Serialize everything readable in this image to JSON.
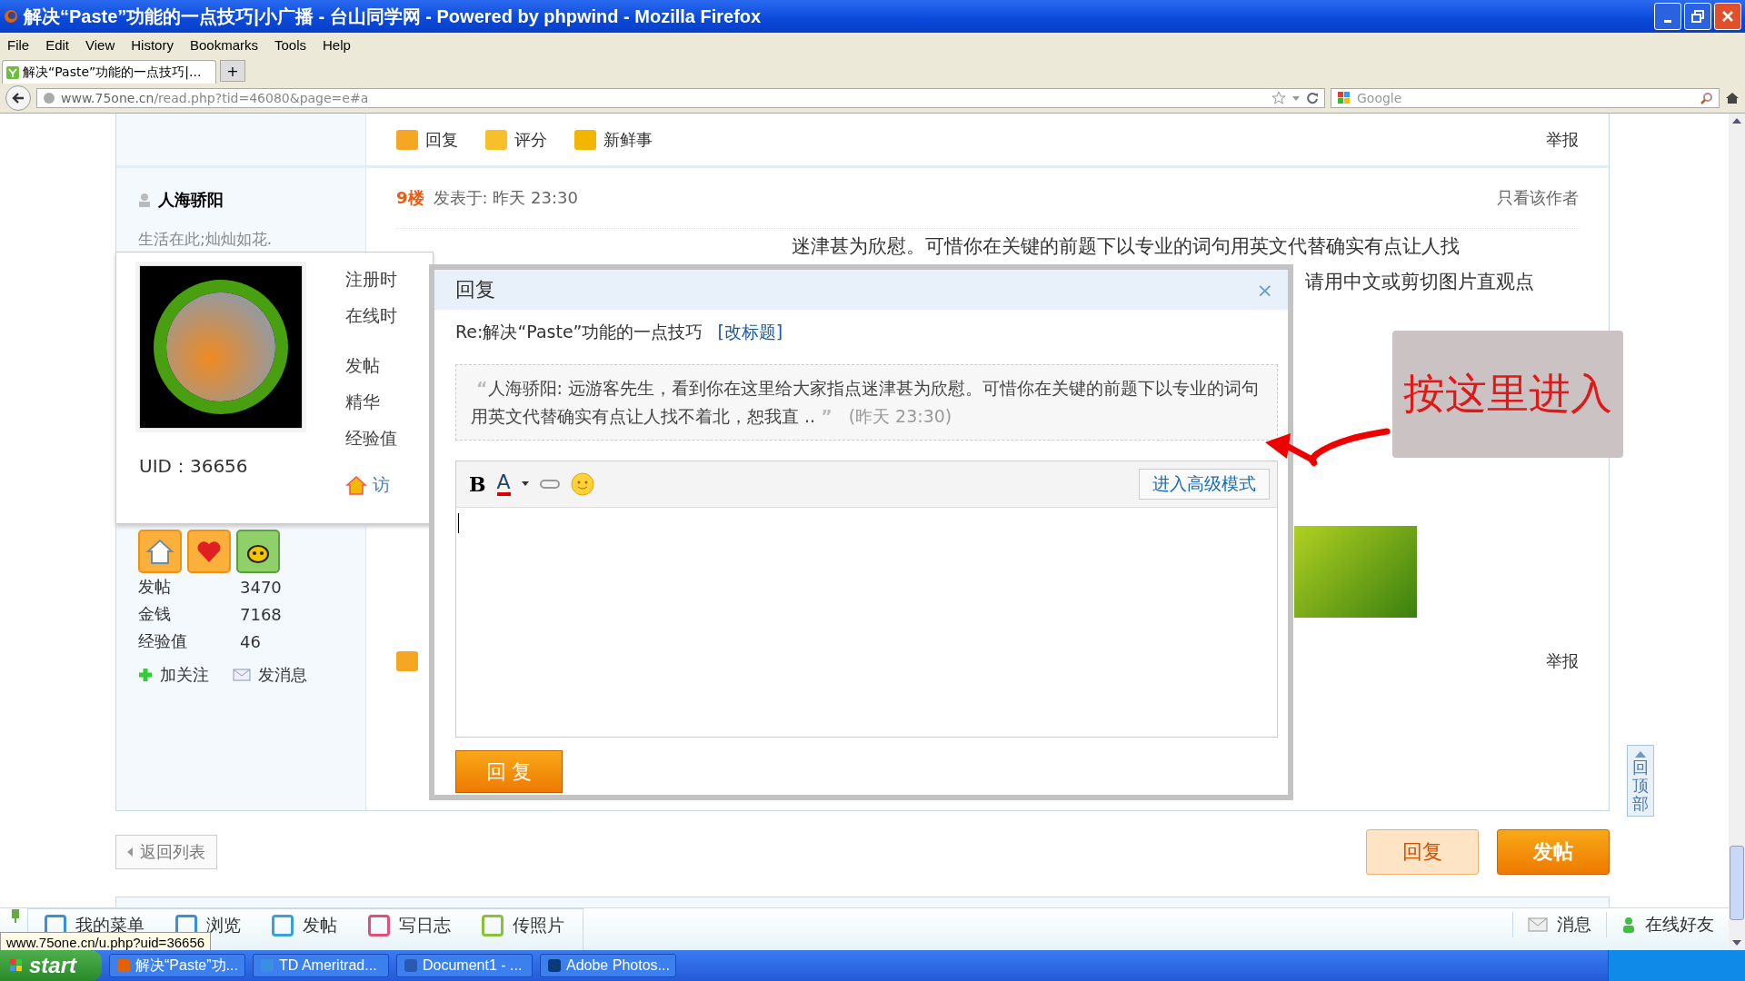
{
  "window": {
    "title": "解决“Paste”功能的一点技巧|小广播 - 台山同学网 - Powered by phpwind - Mozilla Firefox"
  },
  "menu": [
    "File",
    "Edit",
    "View",
    "History",
    "Bookmarks",
    "Tools",
    "Help"
  ],
  "tabs": [
    {
      "label": "解决“Paste”功能的一点技巧|...",
      "selected": true
    }
  ],
  "new_tab": "+",
  "address": {
    "domain": "www.75one.cn",
    "path": "/read.php?tid=46080&page=e#a"
  },
  "search": {
    "placeholder": "Google"
  },
  "prev_post_actions": {
    "items": [
      "回复",
      "评分",
      "新鲜事"
    ],
    "report": "举报"
  },
  "post": {
    "author": "人海骄阳",
    "signature": "生活在此;灿灿如花.",
    "floor": "9楼",
    "posted": "发表于: 昨天 23:30",
    "only_author": "只看该作者",
    "text_lines": [
      "迷津甚为欣慰。可惜你在关键的前题下以专业的词句用英文代替确实有点让人找",
      "请用中文或剪切图片直观点"
    ],
    "stats": [
      {
        "label": "发帖",
        "value": "3470"
      },
      {
        "label": "金钱",
        "value": "7168"
      },
      {
        "label": "经验值",
        "value": "46"
      }
    ],
    "follow": "加关注",
    "message": "发消息",
    "report": "举报"
  },
  "user_card": {
    "uid_label": "UID：",
    "uid": "36656",
    "fields": [
      "注册时",
      "在线时",
      "发帖",
      "精华",
      "经验值"
    ],
    "visit": "访"
  },
  "page_buttons": {
    "back": "返回列表",
    "reply": "回复",
    "new_post": "发帖"
  },
  "dialog": {
    "title": "回复",
    "close": "×",
    "subject": "Re:解决“Paste”功能的一点技巧",
    "edit_subject": "[改标题]",
    "quote": "人海骄阳:  远游客先生，看到你在这里给大家指点迷津甚为欣慰。可惜你在关键的前题下以专业的词句用英文代替确实有点让人找不着北，恕我直 ..",
    "quote_time": "(昨天 23:30)",
    "quote_open": "“",
    "quote_close": "”",
    "bold": "B",
    "font_color_label": "A",
    "advanced": "进入高级模式",
    "submit": "回 复"
  },
  "annotation": {
    "text": "按这里进入"
  },
  "back_to_top": "回顶部",
  "bottom_bar": {
    "left": [
      "我的菜单",
      "浏览",
      "发帖",
      "写日志",
      "传照片"
    ],
    "right": [
      "消息",
      "在线好友"
    ]
  },
  "status_url": "www.75one.cn/u.php?uid=36656",
  "taskbar": {
    "start": "start",
    "items": [
      "解决“Paste”功...",
      "TD Ameritrad...",
      "Document1 - ...",
      "Adobe Photos..."
    ]
  }
}
